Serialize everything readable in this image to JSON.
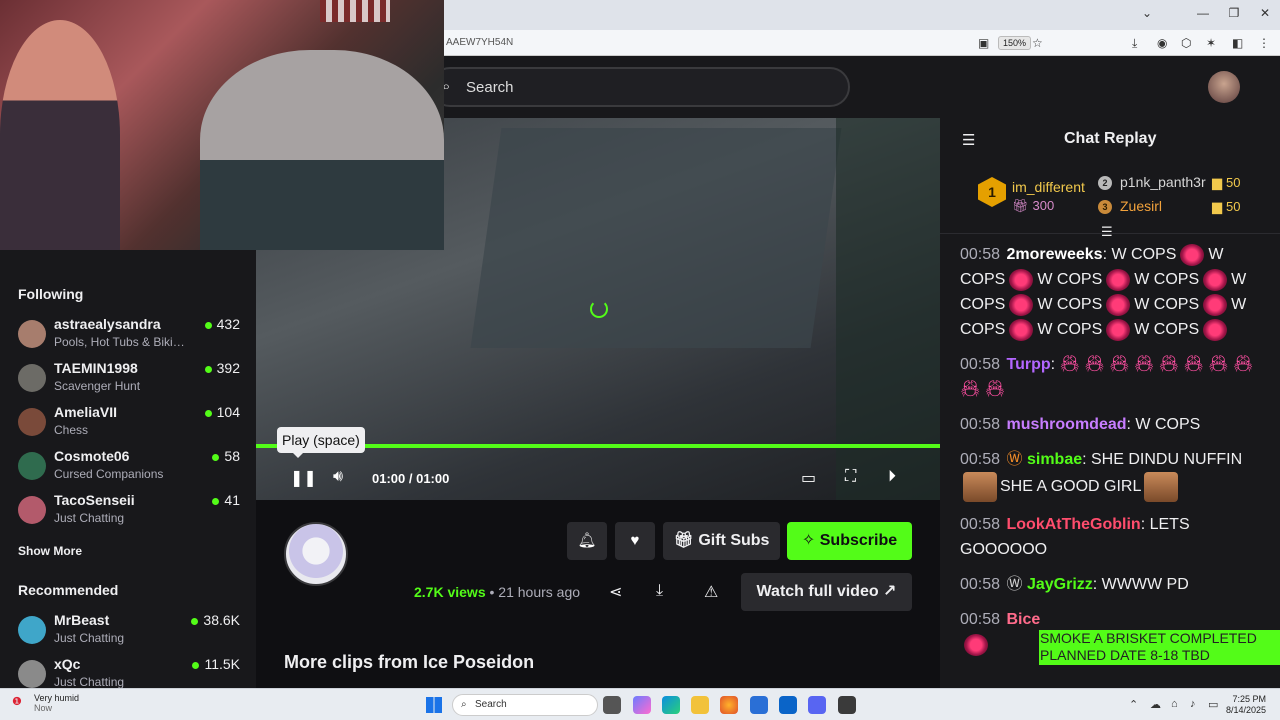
{
  "browser": {
    "url_fragment": "AAEW7YH54N",
    "zoom": "150%"
  },
  "header": {
    "search_placeholder": "Search"
  },
  "sidebar": {
    "following_title": "Following",
    "following": [
      {
        "name": "astraealysandra",
        "category": "Pools, Hot Tubs & Biki…",
        "viewers": "432"
      },
      {
        "name": "TAEMIN1998",
        "category": "Scavenger Hunt",
        "viewers": "392"
      },
      {
        "name": "AmeliaVII",
        "category": "Chess",
        "viewers": "104"
      },
      {
        "name": "Cosmote06",
        "category": "Cursed Companions",
        "viewers": "58"
      },
      {
        "name": "TacoSenseii",
        "category": "Just Chatting",
        "viewers": "41"
      }
    ],
    "show_more": "Show More",
    "recommended_title": "Recommended",
    "recommended": [
      {
        "name": "MrBeast",
        "category": "Just Chatting",
        "viewers": "38.6K"
      },
      {
        "name": "xQc",
        "category": "Just Chatting",
        "viewers": "11.5K"
      }
    ]
  },
  "player": {
    "tooltip": "Play (space)",
    "time": "01:00 / 01:00",
    "progress_fraction": 1.0
  },
  "clip": {
    "gift_subs": "Gift Subs",
    "subscribe": "Subscribe",
    "views_count": "2.7K views",
    "posted": "21 hours ago",
    "watch_full": "Watch full video",
    "more_clips": "More clips from Ice Poseidon"
  },
  "chat": {
    "title": "Chat Replay",
    "top_gifter": {
      "rank": "1",
      "name": "im_different",
      "amount": "300"
    },
    "gifters": [
      {
        "rank": "2",
        "name": "p1nk_panth3r",
        "amount": "50"
      },
      {
        "rank": "3",
        "name": "Zuesirl",
        "amount": "50"
      }
    ],
    "messages": [
      {
        "ts": "00:58",
        "user": "2moreweeks",
        "sep": ":"
      },
      {
        "ts": "00:58",
        "user": "Turpp",
        "sep": ":"
      },
      {
        "ts": "00:58",
        "user": "mushroomdead",
        "sep": ":",
        "text": " W COPS"
      },
      {
        "ts": "00:58",
        "user": "simbae",
        "sep": ":",
        "text": " SHE DINDU NUFFIN",
        "text2": "SHE A GOOD GIRL"
      },
      {
        "ts": "00:58",
        "user": "LookAtTheGoblin",
        "sep": ":",
        "text": " LETS GOOOOOO"
      },
      {
        "ts": "00:58",
        "user": "JayGrizz",
        "sep": ":",
        "text": " WWWW PD"
      },
      {
        "ts": "00:58",
        "user": "Bice",
        "sep": ""
      }
    ],
    "wcops": "W COPS",
    "overlay_line1": "SMOKE A BRISKET COMPLETED",
    "overlay_line2": "PLANNED DATE 8-18 TBD",
    "colors": {
      "user1": "#ffffff",
      "user2": "#b366ff",
      "user3": "#c77dff",
      "user4": "#53fc18",
      "user5": "#ff4d6d",
      "user6": "#53fc18",
      "user7": "#ff6b8b"
    }
  },
  "taskbar": {
    "weather": "Very humid",
    "weather_sub": "Now",
    "search": "Search",
    "time": "7:25 PM",
    "date": "8/14/2025"
  },
  "colors": {
    "accent": "#53fc18",
    "bg": "#0f0f12",
    "panel": "#18181b"
  }
}
